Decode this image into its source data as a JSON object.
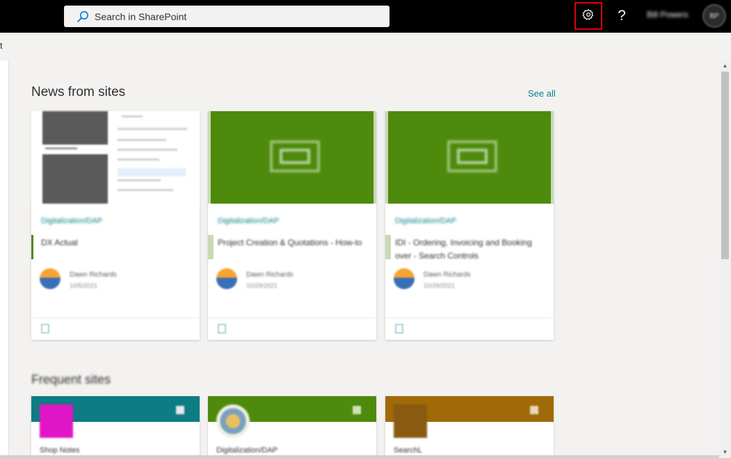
{
  "suitebar": {
    "search_placeholder": "Search in SharePoint",
    "help_label": "?",
    "user_name": "Bill Powers",
    "avatar_initials": "BP"
  },
  "commandbar": {
    "fragment": "t"
  },
  "news": {
    "title": "News from sites",
    "see_all": "See all",
    "cards": [
      {
        "site": "Digitalization/DAP",
        "headline": "DX Actual",
        "author": "Dawn Richards",
        "date": "10/5/2021"
      },
      {
        "site": "Digitalization/DAP",
        "headline": "Project Creation & Quotations - How-to",
        "author": "Dawn Richards",
        "date": "10/29/2021"
      },
      {
        "site": "Digitalization/DAP",
        "headline": "IDI - Ordering, Invoicing and Booking over - Search Controls",
        "author": "Dawn Richards",
        "date": "10/29/2021"
      }
    ]
  },
  "frequent": {
    "title": "Frequent sites",
    "cards": [
      {
        "name": "Shop Notes",
        "band_color": "#0d7c83",
        "logo_color": "#e015c8"
      },
      {
        "name": "Digitalization/DAP",
        "band_color": "#4e8a0c",
        "logo_color": "#e8e8d0"
      },
      {
        "name": "SearchL",
        "band_color": "#a06a08",
        "logo_color": "#8a5a10"
      }
    ]
  },
  "colors": {
    "accent": "#038387",
    "highlight_border": "#e00000",
    "green": "#4e8a0c"
  }
}
